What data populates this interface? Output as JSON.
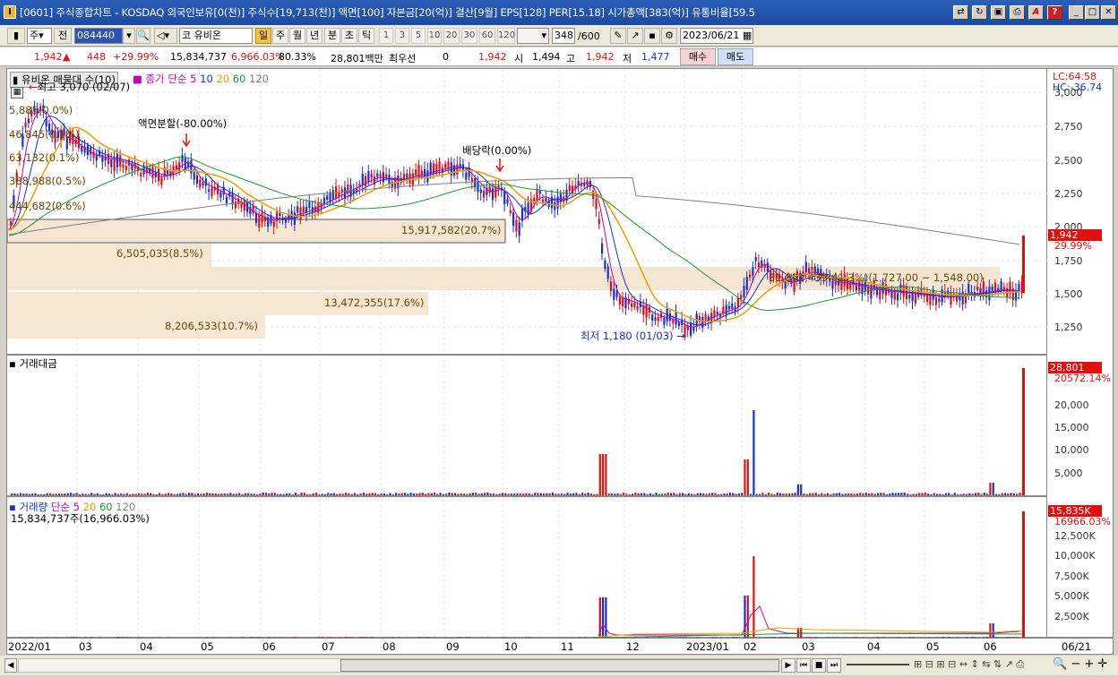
{
  "window": {
    "title": "[0601] 주식종합차트 - KOSDAQ 외국인보유[0(천)] 주식수[19,713(천)] 액면[100] 자본금[20(억)] 결산[9월] EPS[128] PER[15.18] 시가총액[383(억)] 유통비율[59.5"
  },
  "toolbar": {
    "type": "주",
    "prev": "전",
    "code": "084440",
    "market": "코",
    "name": "유비온",
    "periods": [
      "일",
      "주",
      "월",
      "년",
      "분",
      "초",
      "틱"
    ],
    "numbers": [
      "1",
      "3",
      "5",
      "10",
      "20",
      "30",
      "60",
      "120"
    ],
    "count": "348",
    "total": "/600",
    "date": "2023/06/21"
  },
  "quote": {
    "price": "1,942",
    "arrow": "▲",
    "change": "448",
    "pct": "+29.99%",
    "volume": "15,834,737",
    "vol_pct": "6,966.03%",
    "rate": "80.33%",
    "amount": "28,801백만",
    "pref_label": "최우선",
    "pref_val": "0",
    "pref_price": "1,942",
    "open_l": "시",
    "open": "1,494",
    "high_l": "고",
    "high": "1,942",
    "low_l": "저",
    "low": "1,477",
    "buy": "매수",
    "sell": "매도"
  },
  "price_panel": {
    "legend_name": "유비온 매물대 수(10)",
    "legend_ma": "종가 단순 5",
    "ma": [
      "10",
      "20",
      "60",
      "120"
    ],
    "high_note": "최고 3,070 (02/07)",
    "low_note": "최저 1,180 (01/03)",
    "split_note": "액면분할(-80.00%)",
    "div_note": "배당락(0.00%)",
    "lc": "LC:64.58",
    "hc": "HC:-36.74",
    "price_tag": "1,942",
    "pct_tag": "29.99%"
  },
  "volume_profile": [
    {
      "label": "5,885(0.0%)"
    },
    {
      "label": "46,845(0.1%)"
    },
    {
      "label": "63,132(0.1%)"
    },
    {
      "label": "388,988(0.5%)"
    },
    {
      "label": "444,682(0.6%)"
    },
    {
      "label": "15,917,582(20.7%)"
    },
    {
      "label": "6,505,035(8.5%)"
    },
    {
      "label": "31,891,439(41.3%)(1,727.00 ~ 1,548.00)"
    },
    {
      "label": "13,472,355(17.6%)"
    },
    {
      "label": "8,206,533(10.7%)"
    }
  ],
  "price_axis": [
    "3,000",
    "2,750",
    "2,500",
    "2,250",
    "2,000",
    "1,750",
    "1,500",
    "1,250"
  ],
  "amount_panel": {
    "title": "거래대금",
    "tag": "28,801",
    "tag2": "20572.14%",
    "axis": [
      "20,000",
      "15,000",
      "10,000",
      "5,000"
    ]
  },
  "volume_panel": {
    "title": "거래량",
    "ma_label": "단순 5",
    "ma": [
      "20",
      "60",
      "120"
    ],
    "value": "15,834,737주(16,966.03%)",
    "tag": "15,835K",
    "tag2": "16966.03%",
    "axis": [
      "12,500K",
      "10,000K",
      "7,500K",
      "5,000K",
      "2,500K"
    ]
  },
  "x_axis": [
    "2022/01",
    "03",
    "04",
    "05",
    "06",
    "07",
    "08",
    "09",
    "10",
    "11",
    "12",
    "2023/01",
    "02",
    "03",
    "04",
    "05",
    "06",
    "06/21"
  ],
  "colors": {
    "up": "#e01010",
    "down": "#1a2fd0",
    "ma5": "#c000c0",
    "ma10": "#1a2fd0",
    "ma20": "#e8a000",
    "ma60": "#1a9a30",
    "ma120": "#808080",
    "profile": "#f5e6d3"
  },
  "chart_data": {
    "type": "candlestick",
    "ylim": [
      1150,
      3070
    ],
    "last_close": 1942,
    "last_volume": 15834737,
    "last_amount": 28801
  }
}
